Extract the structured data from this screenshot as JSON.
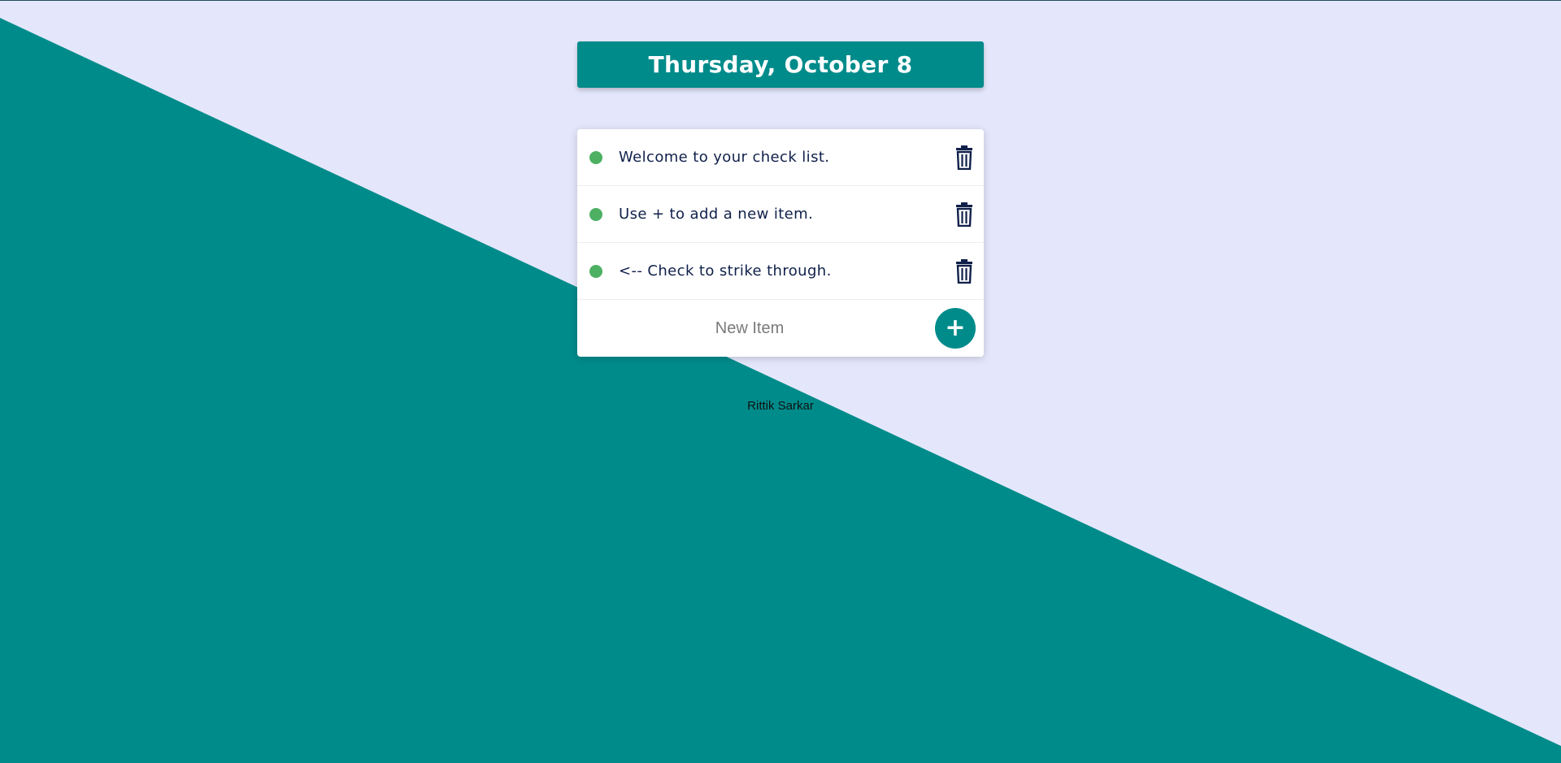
{
  "colors": {
    "background": "#e4e7fb",
    "accent": "#008b8b",
    "check": "#4db063",
    "text": "#10204a",
    "card": "#ffffff"
  },
  "header": {
    "date": "Thursday, October 8"
  },
  "items": [
    {
      "text": "Welcome to your check list.",
      "check_icon": "circle-checkbox-icon",
      "delete_icon": "trash-icon"
    },
    {
      "text": "Use + to add a new item.",
      "check_icon": "circle-checkbox-icon",
      "delete_icon": "trash-icon"
    },
    {
      "text": "<-- Check to strike through.",
      "check_icon": "circle-checkbox-icon",
      "delete_icon": "trash-icon"
    }
  ],
  "new_item": {
    "placeholder": "New Item",
    "value": "",
    "add_label": "+"
  },
  "footer": {
    "author": "Rittik Sarkar"
  }
}
